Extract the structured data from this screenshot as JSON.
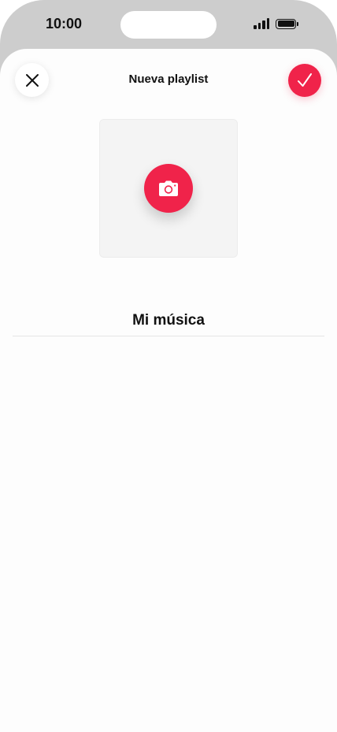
{
  "status_bar": {
    "time": "10:00",
    "icons": [
      "signal-icon",
      "battery-icon"
    ]
  },
  "header": {
    "title": "Nueva playlist",
    "close_icon": "close-icon",
    "confirm_icon": "checkmark-icon"
  },
  "cover": {
    "icon": "camera-icon"
  },
  "playlist_name": {
    "value": "Mi música"
  },
  "colors": {
    "accent": "#f0234a",
    "frame": "#cdcdcd",
    "sheet": "#fdfdfd"
  }
}
